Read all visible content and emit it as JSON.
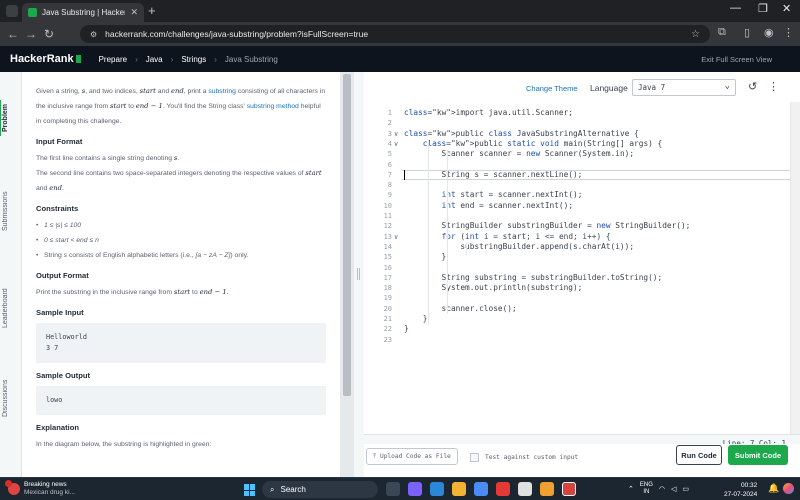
{
  "browser": {
    "tab_title": "Java Substring | HackerRank",
    "new_tab": "+",
    "url": "hackerrank.com/challenges/java-substring/problem?isFullScreen=true"
  },
  "header": {
    "logo": "HackerRank",
    "crumbs": [
      "Prepare",
      "Java",
      "Strings",
      "Java Substring"
    ],
    "exit_fullscreen": "Exit Full Screen View"
  },
  "side_tabs": [
    "Problem",
    "Submissions",
    "Leaderboard",
    "Discussions"
  ],
  "problem": {
    "intro_1": "Given a string, ",
    "s": "s",
    "intro_2": ", and two indices, ",
    "start": "start",
    "and": " and ",
    "end": "end",
    "intro_3": ", print a ",
    "substring_link": "substring",
    "intro_4": " consisting of all characters in the inclusive range from ",
    "from": " to ",
    "end_minus": "end − 1",
    "intro_5": ". You'll find the String class' ",
    "method_link": "substring method",
    "intro_6": " helpful in completing this challenge.",
    "input_format_h": "Input Format",
    "input_1": "The first line contains a single string denoting ",
    "input_2": "The second line contains two space-separated integers denoting the respective values of ",
    "constraints_h": "Constraints",
    "c1": "1 ≤ |s| ≤ 100",
    "c2": "0 ≤ start < end ≤ n",
    "c3a": "String ",
    "c3b": " consists of English alphabetic letters (i.e., ",
    "c3c": "[a − zA − Z]",
    "c3d": ") only.",
    "output_format_h": "Output Format",
    "output_1": "Print the substring in the inclusive range from ",
    "sample_input_h": "Sample Input",
    "sample_input": "Helloworld\n3 7",
    "sample_output_h": "Sample Output",
    "sample_output": "lowo",
    "explanation_h": "Explanation",
    "explanation_1": "In the diagram below, the substring is highlighted in green:"
  },
  "editor": {
    "change_theme": "Change Theme",
    "language_label": "Language",
    "language": "Java 7",
    "status": "Line: 7 Col: 1",
    "lines": [
      "import java.util.Scanner;",
      "",
      "public class JavaSubstringAlternative {",
      "    public static void main(String[] args) {",
      "        Scanner scanner = new Scanner(System.in);",
      "",
      "        String s = scanner.nextLine();",
      "",
      "        int start = scanner.nextInt();",
      "        int end = scanner.nextInt();",
      "",
      "        StringBuilder substringBuilder = new StringBuilder();",
      "        for (int i = start; i <= end; i++) {",
      "            substringBuilder.append(s.charAt(i));",
      "        }",
      "",
      "        String substring = substringBuilder.toString();",
      "        System.out.println(substring);",
      "",
      "        scanner.close();",
      "    }",
      "}",
      ""
    ]
  },
  "actions": {
    "upload": "Upload Code as File",
    "custom_input": "Test against custom input",
    "run": "Run Code",
    "submit": "Submit Code"
  },
  "taskbar": {
    "news_title": "Breaking news",
    "news_sub": "Mexican drug ki...",
    "search": "Search",
    "lang_1": "ENG",
    "lang_2": "IN",
    "time": "00:32",
    "date": "27-07-2024"
  }
}
